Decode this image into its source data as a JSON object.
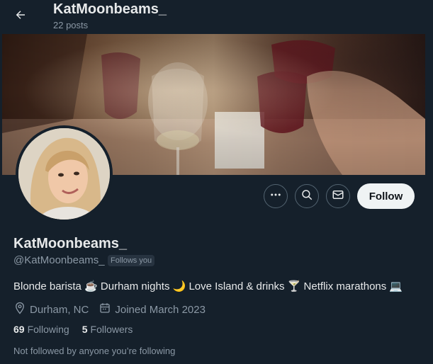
{
  "header": {
    "name": "KatMoonbeams_",
    "posts": "22 posts"
  },
  "profile": {
    "display_name": "KatMoonbeams_",
    "handle": "@KatMoonbeams_",
    "follows_you_badge": "Follows you",
    "bio": "Blonde barista ☕ Durham nights 🌙 Love Island & drinks 🍸 Netflix marathons 💻",
    "location": "Durham, NC",
    "joined": "Joined March 2023",
    "following_count": "69",
    "following_label": "Following",
    "followers_count": "5",
    "followers_label": "Followers",
    "not_followed_text": "Not followed by anyone you’re following"
  },
  "actions": {
    "follow_label": "Follow",
    "more_icon": "more-icon",
    "search_icon": "search-icon",
    "message_icon": "message-icon"
  },
  "colors": {
    "background": "#15202b",
    "primary_text": "#e7e9ea",
    "secondary_text": "#8b98a5",
    "follow_button_bg": "#eff3f4"
  }
}
